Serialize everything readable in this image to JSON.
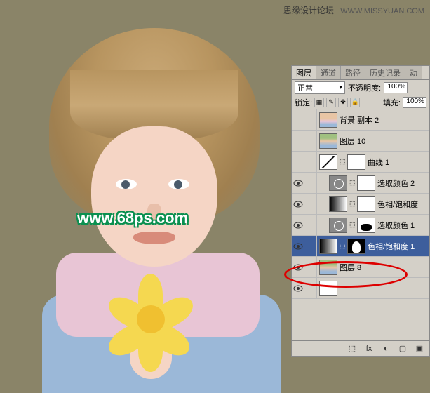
{
  "watermark": {
    "top_text": "思缘设计论坛",
    "top_url": "WWW.MISSYUAN.COM",
    "mid_text": "www.68ps.com"
  },
  "panel": {
    "tabs": {
      "layers": "图层",
      "channels": "通道",
      "paths": "路径",
      "history": "历史记录",
      "actions": "动"
    },
    "blend_mode": "正常",
    "opacity_label": "不透明度:",
    "opacity_value": "100%",
    "lock_label": "锁定:",
    "fill_label": "填充:",
    "fill_value": "100%"
  },
  "layers": [
    {
      "name": "背景 副本 2",
      "visible": false,
      "thumb": "photo1",
      "mask": null,
      "indent": 0
    },
    {
      "name": "图层 10",
      "visible": false,
      "thumb": "photo2",
      "mask": null,
      "indent": 0
    },
    {
      "name": "曲线 1",
      "visible": false,
      "thumb": "curve",
      "mask": "mask-white",
      "indent": 0
    },
    {
      "name": "选取颜色 2",
      "visible": true,
      "thumb": "adj-circle",
      "mask": "mask-white",
      "indent": 1
    },
    {
      "name": "色相/饱和度",
      "visible": true,
      "thumb": "gradient",
      "mask": "mask-white",
      "indent": 1
    },
    {
      "name": "选取颜色 1",
      "visible": true,
      "thumb": "adj-circle",
      "mask": "mask-blob",
      "indent": 1
    },
    {
      "name": "色相/饱和度 1",
      "visible": true,
      "thumb": "gradient",
      "mask": "mask-silh",
      "indent": 0,
      "selected": true
    },
    {
      "name": "图层 8",
      "visible": true,
      "thumb": "photo2",
      "mask": null,
      "indent": 0
    },
    {
      "name": "",
      "visible": true,
      "thumb": "mask-white",
      "mask": null,
      "indent": 0
    }
  ],
  "footer_icons": [
    "⬚",
    "fx",
    "◐",
    "▢",
    "▣"
  ]
}
